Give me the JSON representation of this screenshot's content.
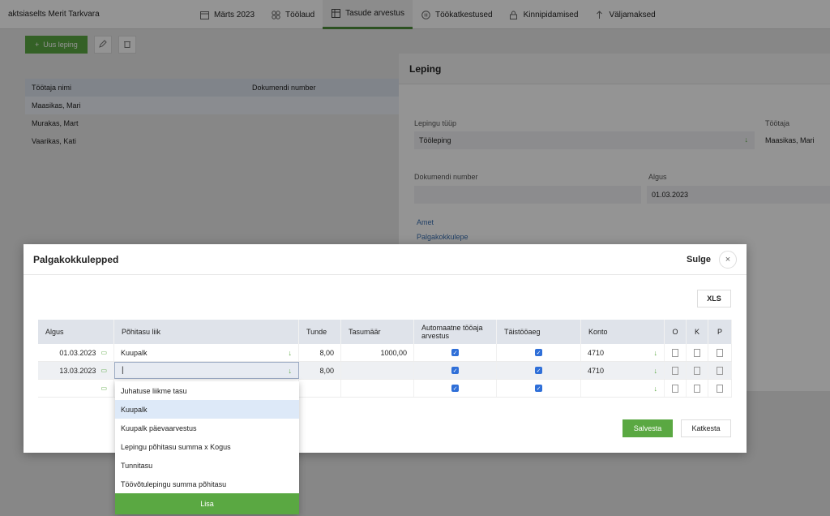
{
  "company": "aktsiaselts Merit Tarkvara",
  "nav": [
    {
      "label": "Märts 2023"
    },
    {
      "label": "Töölaud"
    },
    {
      "label": "Tasude arvestus"
    },
    {
      "label": "Töökatkestused"
    },
    {
      "label": "Kinnipidamised"
    },
    {
      "label": "Väljamaksed"
    }
  ],
  "toolbar": {
    "new_label": "Uus leping"
  },
  "list": {
    "headers": [
      "Töötaja nimi",
      "Dokumendi number"
    ],
    "rows": [
      "Maasikas, Mari",
      "Murakas, Mart",
      "Vaarikas, Kati"
    ]
  },
  "panel": {
    "title": "Leping",
    "type_label": "Lepingu tüüp",
    "type_value": "Tööleping",
    "employee_label": "Töötaja",
    "employee_value": "Maasikas, Mari",
    "docnum_label": "Dokumendi number",
    "start_label": "Algus",
    "start_value": "01.03.2023",
    "link_amet": "Amet",
    "link_palk": "Palgakokkulepe"
  },
  "modal": {
    "title": "Palgakokkulepped",
    "close_label": "Sulge",
    "xls_label": "XLS",
    "headers": {
      "algus": "Algus",
      "liik": "Põhitasu liik",
      "tunde": "Tunde",
      "tasumaar": "Tasumäär",
      "auto": "Automaatne tööaja arvestus",
      "taist": "Täistööaeg",
      "konto": "Konto",
      "o": "O",
      "k": "K",
      "p": "P"
    },
    "rows": [
      {
        "algus": "01.03.2023",
        "liik": "Kuupalk",
        "tunde": "8,00",
        "tasumaar": "1000,00",
        "konto": "4710"
      },
      {
        "algus": "13.03.2023",
        "liik": "",
        "tunde": "8,00",
        "tasumaar": "",
        "konto": "4710"
      },
      {
        "algus": "",
        "liik": "",
        "tunde": "",
        "tasumaar": "",
        "konto": ""
      }
    ],
    "save_label": "Salvesta",
    "cancel_label": "Katkesta"
  },
  "dropdown": {
    "options": [
      "Juhatuse liikme tasu",
      "Kuupalk",
      "Kuupalk päevaarvestus",
      "Lepingu põhitasu summa x Kogus",
      "Tunnitasu",
      "Töövõtulepingu summa põhitasu"
    ],
    "active_index": 1,
    "add_label": "Lisa"
  },
  "colors": {
    "accent": "#5aa842",
    "checkbox": "#2f6fd8"
  }
}
